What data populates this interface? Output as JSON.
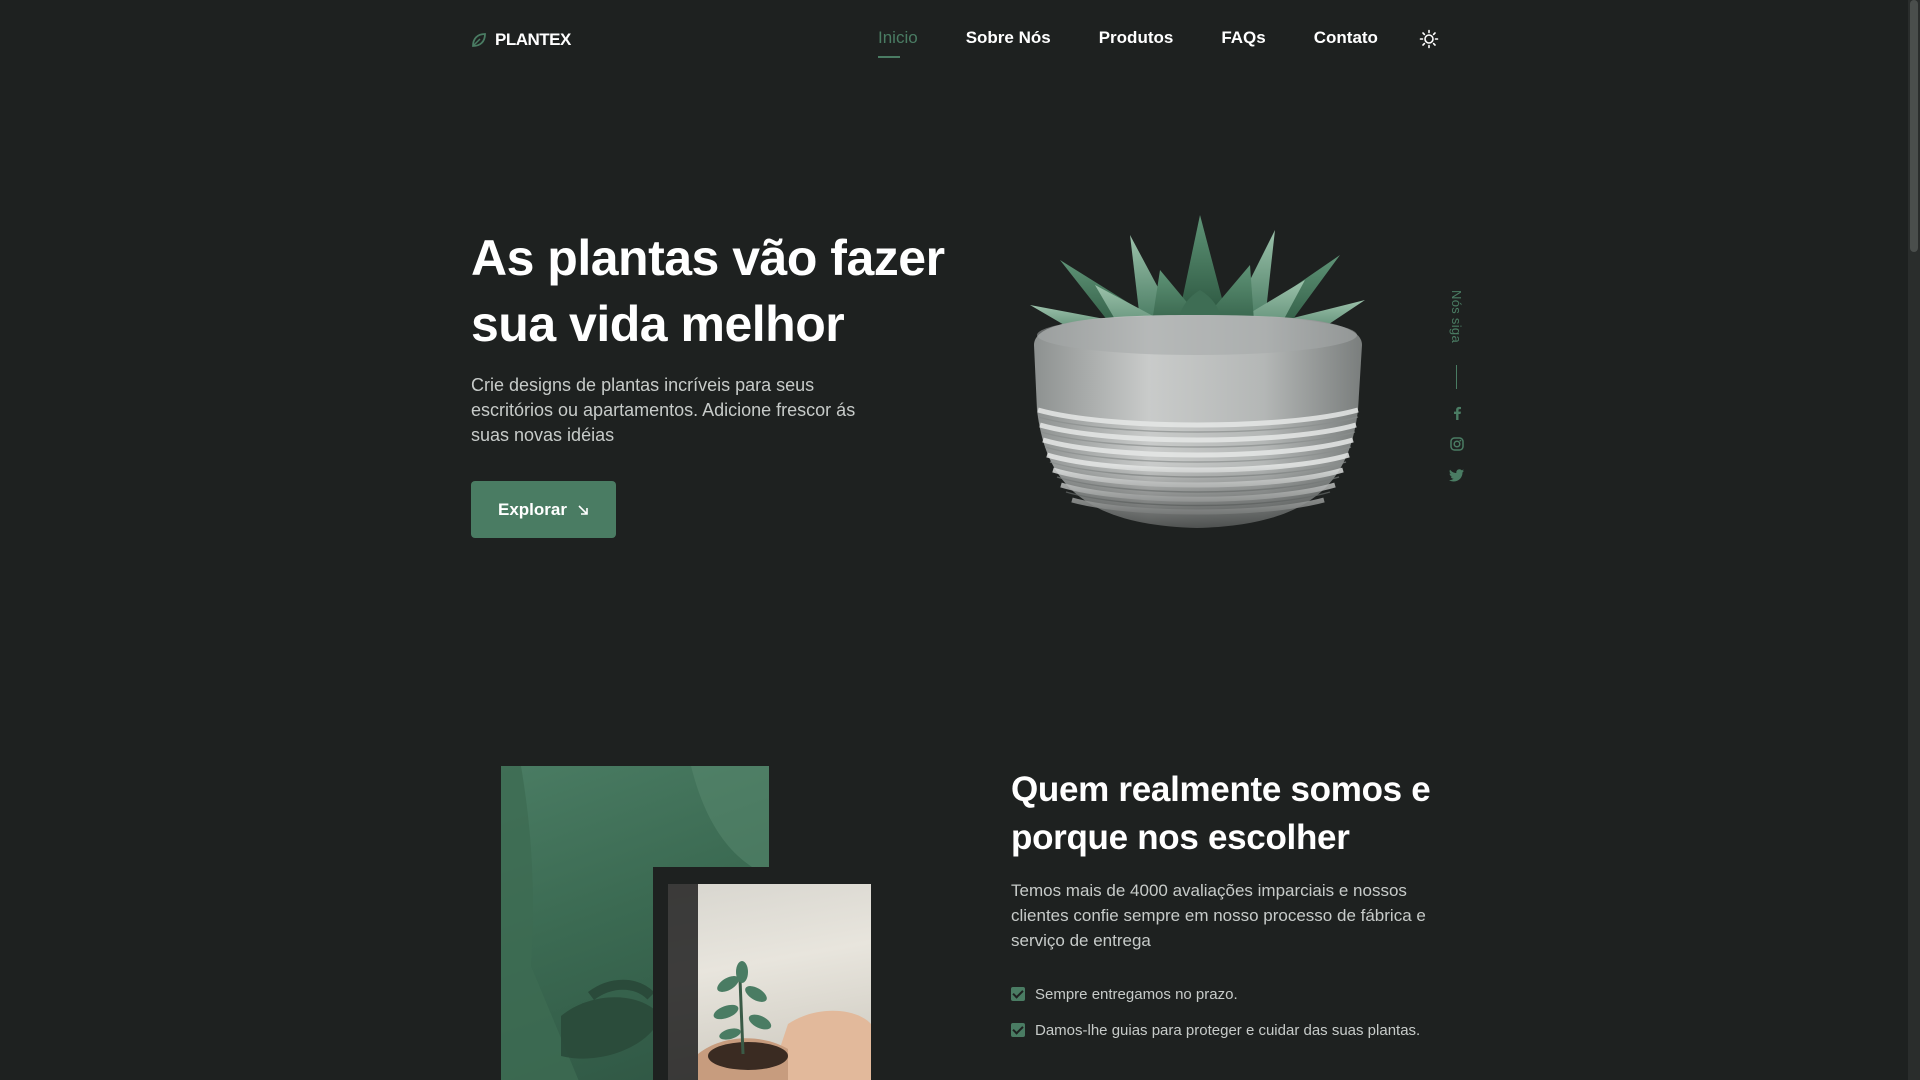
{
  "header": {
    "logo_text": "PLANTEX",
    "nav": [
      {
        "label": "Inicio",
        "active": true
      },
      {
        "label": "Sobre Nós",
        "active": false
      },
      {
        "label": "Produtos",
        "active": false
      },
      {
        "label": "FAQs",
        "active": false
      },
      {
        "label": "Contato",
        "active": false
      }
    ],
    "theme_icon": "sun-icon"
  },
  "hero": {
    "title": "As plantas vão fazer sua vida melhor",
    "description": "Crie designs de plantas incríveis para seus escritórios ou apartamentos. Adicione frescor ás suas novas idéias",
    "button_label": "Explorar",
    "button_icon": "arrow-down-right-icon"
  },
  "social": {
    "label": "Nós siga",
    "icons": [
      "facebook-icon",
      "instagram-icon",
      "twitter-icon"
    ]
  },
  "about": {
    "title": "Quem realmente somos e porque nos escolher",
    "description": "Temos mais de 4000 avaliações imparciais e nossos clientes confie sempre em nosso processo de fábrica e serviço de entrega",
    "items": [
      "Sempre entregamos no prazo.",
      "Damos-lhe guias para proteger e cuidar das suas plantas."
    ]
  },
  "colors": {
    "background": "#1e2120",
    "accent": "#4a7c63",
    "text": "#ffffff",
    "muted_text": "#c7cbc9"
  }
}
